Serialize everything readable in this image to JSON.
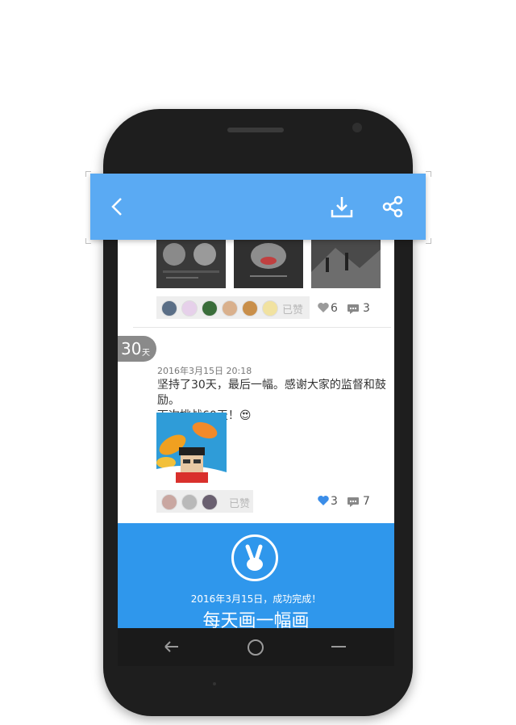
{
  "post1": {
    "liked_label": "已赞",
    "like_count": "6",
    "comment_count": "3"
  },
  "post2": {
    "day_number": "30",
    "day_unit": "天",
    "date": "2016年3月15日  20:18",
    "text_line1": "坚持了30天，最后一幅。感谢大家的监督和鼓励。",
    "text_line2": "下次挑战60天！😍",
    "liked_label": "已赞",
    "like_count": "3",
    "comment_count": "7"
  },
  "completion": {
    "message": "2016年3月15日，成功完成！",
    "slogan": "每天画一幅画"
  },
  "colors": {
    "topbar": "#5aaaf3",
    "completion_bg": "#2f97ec",
    "like_blue": "#3b8de8"
  }
}
